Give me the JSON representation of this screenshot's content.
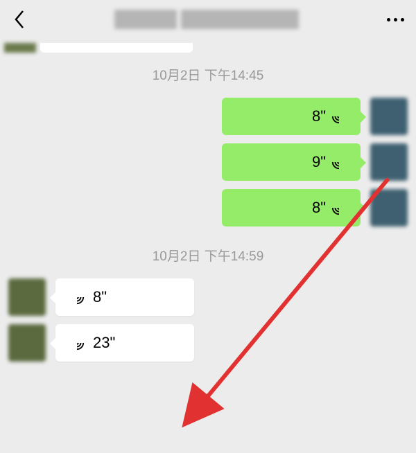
{
  "header": {
    "title": "[blurred]",
    "back_aria": "Back",
    "more_aria": "More"
  },
  "timestamps": {
    "t1": "10月2日 下午14:45",
    "t2": "10月2日 下午14:59"
  },
  "outgoing": [
    {
      "duration": "8\""
    },
    {
      "duration": "9\""
    },
    {
      "duration": "8\""
    }
  ],
  "incoming": [
    {
      "duration": "8\""
    },
    {
      "duration": "23\""
    }
  ],
  "colors": {
    "bubble_out": "#95ec69",
    "bubble_in": "#ffffff",
    "bg": "#ececec",
    "arrow": "#e23131"
  }
}
